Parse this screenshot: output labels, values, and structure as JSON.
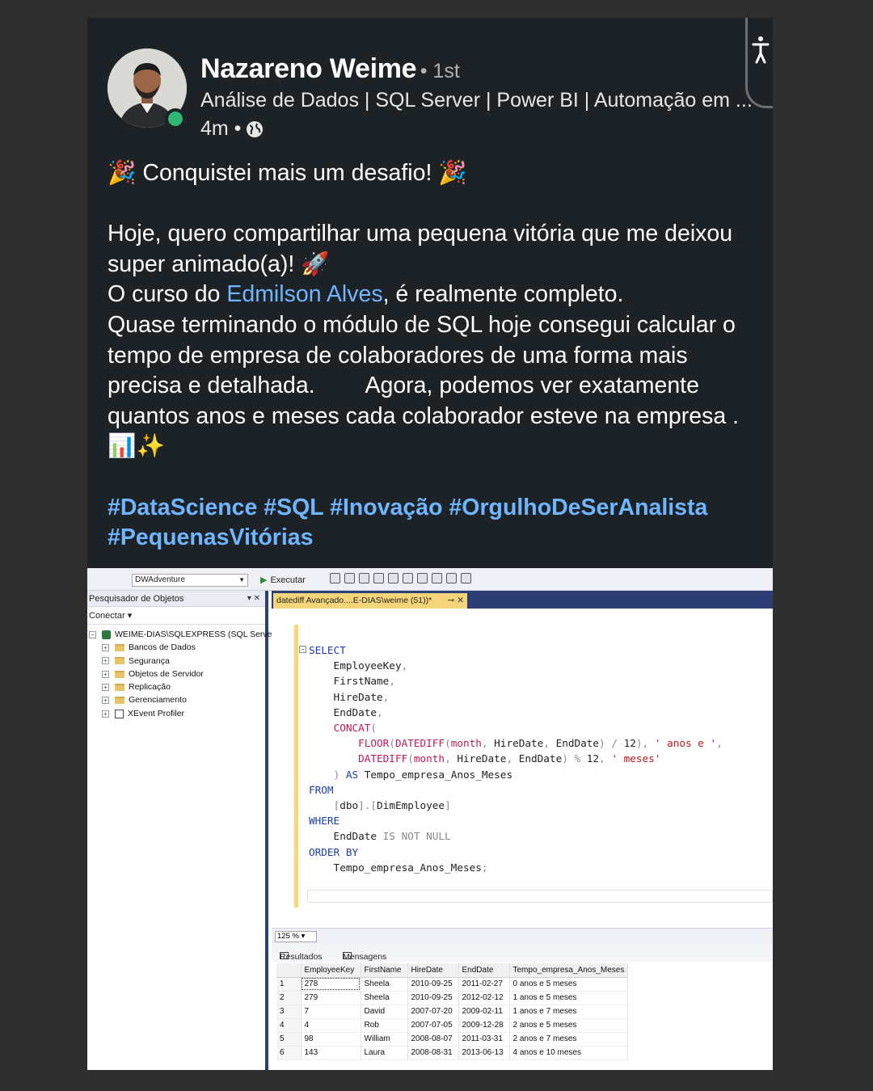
{
  "author": {
    "name": "Nazareno Weime",
    "degree": "• 1st",
    "headline": "Análise de Dados | SQL Server | Power BI | Automação em ...",
    "time": "4m •"
  },
  "post": {
    "line1": "🎉 Conquistei mais um desafio! 🎉",
    "para2a": "Hoje, quero compartilhar uma pequena vitória que me deixou super animado(a)! 🚀",
    "para2b_prefix": "O curso do ",
    "para2b_link": "Edmilson Alves",
    "para2b_suffix": ", é realmente completo.",
    "para2c": "Quase terminando o módulo de SQL hoje consegui calcular o tempo de empresa de colaboradores de uma forma mais precisa e detalhada.        Agora, podemos ver exatamente quantos anos e meses cada colaborador esteve na empresa . 📊✨",
    "hashtags": "#DataScience #SQL #Inovação #OrgulhoDeSerAnalista #PequenasVitórias"
  },
  "ssms": {
    "database": "DWAdventure",
    "execute_label": "Executar",
    "explorer_title": "Pesquisador de Objetos",
    "connect_label": "Conectar ▾",
    "server": "WEIME-DIAS\\SQLEXPRESS (SQL Server",
    "tree_items": [
      "Bancos de Dados",
      "Segurança",
      "Objetos de Servidor",
      "Replicação",
      "Gerenciamento",
      "XEvent Profiler"
    ],
    "tab_title": "datediff Avançado....E-DIAS\\weime (51))*",
    "zoom": "125 %",
    "results_tab": "Resultados",
    "messages_tab": "Mensagens",
    "columns": [
      "EmployeeKey",
      "FirstName",
      "HireDate",
      "EndDate",
      "Tempo_empresa_Anos_Meses"
    ],
    "rows": [
      [
        "1",
        "278",
        "Sheela",
        "2010-09-25",
        "2011-02-27",
        "0 anos e 5 meses"
      ],
      [
        "2",
        "279",
        "Sheela",
        "2010-09-25",
        "2012-02-12",
        "1 anos e 5 meses"
      ],
      [
        "3",
        "7",
        "David",
        "2007-07-20",
        "2009-02-11",
        "1 anos e 7 meses"
      ],
      [
        "4",
        "4",
        "Rob",
        "2007-07-05",
        "2009-12-28",
        "2 anos e 5 meses"
      ],
      [
        "5",
        "98",
        "William",
        "2008-08-07",
        "2011-03-31",
        "2 anos e 7 meses"
      ],
      [
        "6",
        "143",
        "Laura",
        "2008-08-31",
        "2013-06-13",
        "4 anos e 10 meses"
      ]
    ]
  }
}
